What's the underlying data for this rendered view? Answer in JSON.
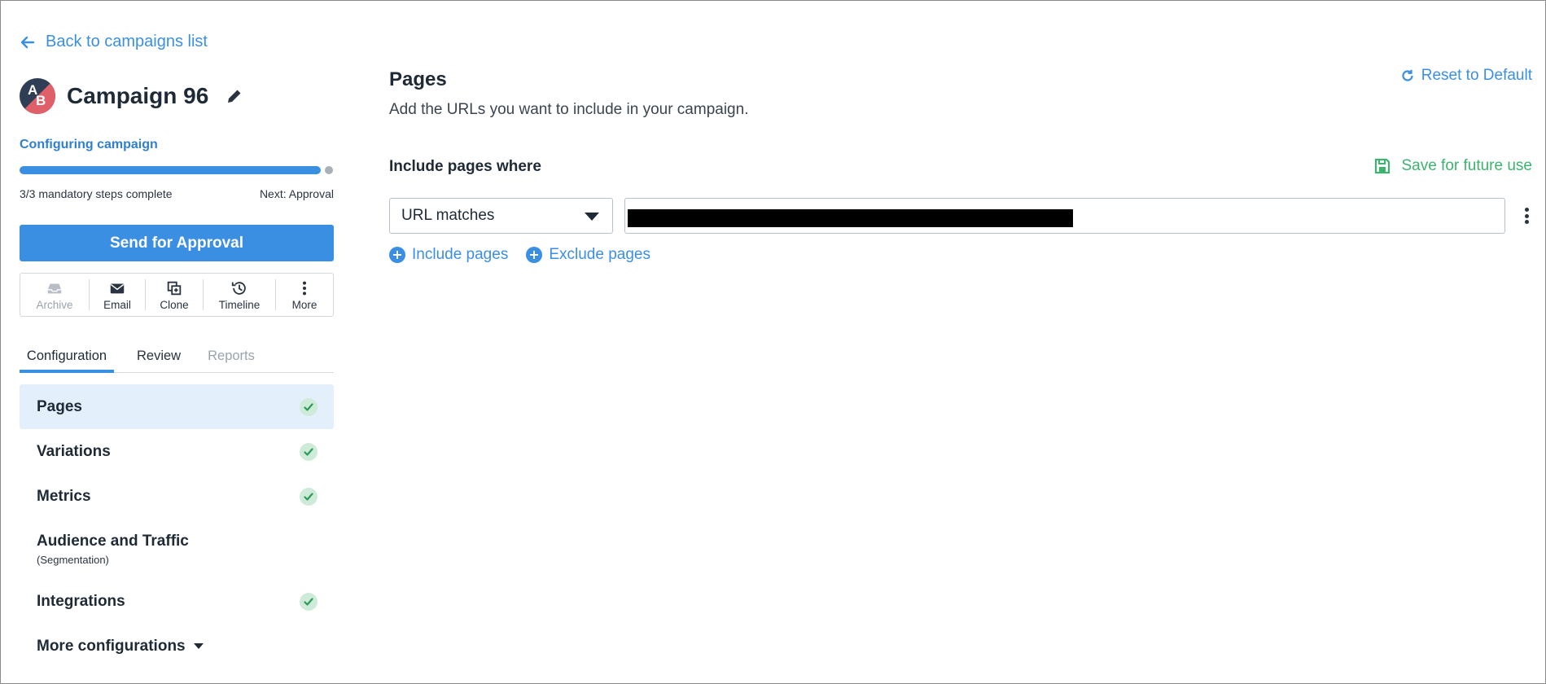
{
  "colors": {
    "accent": "#3b8fe3",
    "success": "#3cb36e",
    "active_bg": "#e3f0fb",
    "avatar_dark": "#2f3e54",
    "avatar_red": "#e0606a"
  },
  "sidebar": {
    "back_link": "Back to campaigns list",
    "avatar": {
      "letter_a": "A",
      "letter_b": "B"
    },
    "campaign_title": "Campaign 96",
    "status_label": "Configuring campaign",
    "progress": {
      "percent": 100,
      "steps_text": "3/3 mandatory steps complete",
      "next_text": "Next: Approval"
    },
    "send_button": "Send for Approval",
    "actions": [
      {
        "label": "Archive",
        "icon": "archive-icon",
        "enabled": false
      },
      {
        "label": "Email",
        "icon": "email-icon",
        "enabled": true
      },
      {
        "label": "Clone",
        "icon": "clone-icon",
        "enabled": true
      },
      {
        "label": "Timeline",
        "icon": "timeline-icon",
        "enabled": true
      },
      {
        "label": "More",
        "icon": "more-vertical-icon",
        "enabled": true
      }
    ],
    "tabs": [
      {
        "label": "Configuration",
        "state": "active"
      },
      {
        "label": "Review",
        "state": "inactive"
      },
      {
        "label": "Reports",
        "state": "disabled"
      }
    ],
    "nav_items": [
      {
        "label": "Pages",
        "complete": true,
        "active": true
      },
      {
        "label": "Variations",
        "complete": true,
        "active": false
      },
      {
        "label": "Metrics",
        "complete": true,
        "active": false
      },
      {
        "label": "Audience and Traffic",
        "sub": "(Segmentation)",
        "complete": false,
        "active": false
      },
      {
        "label": "Integrations",
        "complete": true,
        "active": false
      }
    ],
    "more_configurations": "More configurations"
  },
  "main": {
    "title": "Pages",
    "description": "Add the URLs you want to include in your campaign.",
    "reset_link": "Reset to Default",
    "section_label": "Include pages where",
    "save_link": "Save for future use",
    "rule": {
      "match_type": "URL matches",
      "url_value": ""
    },
    "include_link": "Include pages",
    "exclude_link": "Exclude pages"
  }
}
